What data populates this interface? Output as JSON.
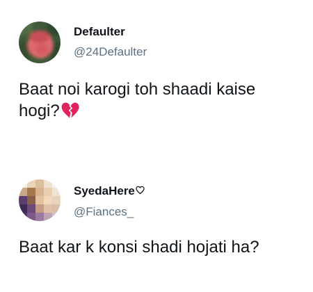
{
  "tweets": [
    {
      "display_name": "Defaulter",
      "handle": "@24Defaulter",
      "text_line1": "Baat noi karogi toh shaadi kaise",
      "text_line2": "hogi?",
      "trailing_emoji": "broken-heart-icon"
    },
    {
      "display_name": "SyedaHere",
      "name_emoji": "white-heart-icon",
      "handle": "@Fiances_",
      "text_line1": "Baat kar k konsi shadi hojati ha?"
    }
  ],
  "colors": {
    "text": "#0f1419",
    "secondary_text": "#5b7083",
    "broken_heart": "#e0245e",
    "background": "#ffffff"
  }
}
